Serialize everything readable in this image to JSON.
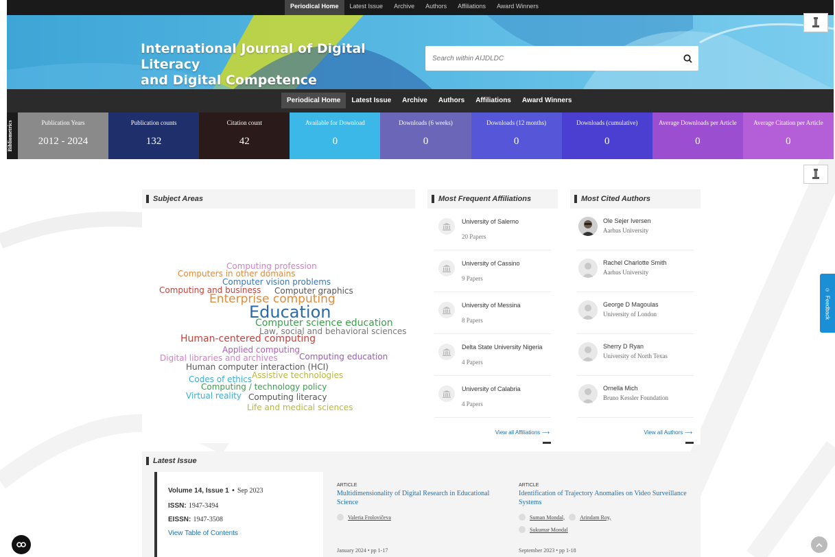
{
  "nav": {
    "tabs": [
      "Periodical Home",
      "Latest Issue",
      "Archive",
      "Authors",
      "Affiliations",
      "Award Winners"
    ],
    "active": "Periodical Home"
  },
  "banner": {
    "title_line1": "International Journal of Digital Literacy",
    "title_line2": "and Digital Competence",
    "search_placeholder": "Search within AIJDLDC"
  },
  "bibliometrics": {
    "label": "Bibliometrics",
    "metrics": [
      {
        "label": "Publication Years",
        "value": "2012 - 2024",
        "color": "#8a8a8a"
      },
      {
        "label": "Publication counts",
        "value": "132",
        "color": "#1f2f6b"
      },
      {
        "label": "Citation count",
        "value": "42",
        "color": "#2b1a1a"
      },
      {
        "label": "Available for Download",
        "value": "0",
        "color": "#3bb7e8"
      },
      {
        "label": "Downloads (6 weeks)",
        "value": "0",
        "color": "#6b66b8"
      },
      {
        "label": "Downloads (12 months)",
        "value": "0",
        "color": "#5656d8"
      },
      {
        "label": "Downloads (cumulative)",
        "value": "0",
        "color": "#4a3fd0"
      },
      {
        "label": "Average Downloads per Article",
        "value": "0",
        "color": "#9b4fd0"
      },
      {
        "label": "Average Citation per Article",
        "value": "0",
        "color": "#b45fd8"
      }
    ]
  },
  "feedback_label": "Feedback",
  "subject_areas": {
    "title": "Subject Areas",
    "words": [
      {
        "text": "Computing profession",
        "color": "#d47fc4"
      },
      {
        "text": "Computers in other domains",
        "color": "#e08b3a"
      },
      {
        "text": "Computer vision problems",
        "color": "#3a74b8"
      },
      {
        "text": "Computing and business",
        "color": "#c8403a"
      },
      {
        "text": "Computer graphics",
        "color": "#555555"
      },
      {
        "text": "Enterprise computing",
        "color": "#e08b3a"
      },
      {
        "text": "Education",
        "color": "#2a6aa8"
      },
      {
        "text": "Computer science education",
        "color": "#3aa04a"
      },
      {
        "text": "Law, social and behavioral sciences",
        "color": "#777777"
      },
      {
        "text": "Human-centered computing",
        "color": "#c8403a"
      },
      {
        "text": "Applied computing",
        "color": "#b65ac0"
      },
      {
        "text": "Digital libraries and archives",
        "color": "#d47fc4"
      },
      {
        "text": "Computing education",
        "color": "#9a5ab8"
      },
      {
        "text": "Human computer interaction (HCI)",
        "color": "#555555"
      },
      {
        "text": "Codes of ethics",
        "color": "#3aaed0"
      },
      {
        "text": "Assistive technologies",
        "color": "#b8b83a"
      },
      {
        "text": "Computing / technology policy",
        "color": "#3aa04a"
      },
      {
        "text": "Virtual reality",
        "color": "#3aaed0"
      },
      {
        "text": "Computing literacy",
        "color": "#555555"
      },
      {
        "text": "Life and medical sciences",
        "color": "#b8b83a"
      }
    ]
  },
  "affiliations": {
    "title": "Most Frequent Affiliations",
    "items": [
      {
        "name": "University of Salerno",
        "count": "20 Papers"
      },
      {
        "name": "University of Cassino",
        "count": "9 Papers"
      },
      {
        "name": "University of Messina",
        "count": "8 Papers"
      },
      {
        "name": "Delta State University Nigeria",
        "count": "4 Papers"
      },
      {
        "name": "University of Calabria",
        "count": "4 Papers"
      }
    ],
    "view_all": "View all Affiliations"
  },
  "authors": {
    "title": "Most Cited Authors",
    "items": [
      {
        "name": "Ole Sejer Iversen",
        "inst": "Aarhus University"
      },
      {
        "name": "Rachel Charlotte Smith",
        "inst": "Aarhus University"
      },
      {
        "name": "George D Magoulas",
        "inst": "University of London"
      },
      {
        "name": "Sherry D Ryan",
        "inst": "University of North Texas"
      },
      {
        "name": "Ornella Mich",
        "inst": "Bruno Kessler Foundation"
      }
    ],
    "view_all": "View all Authors"
  },
  "latest_issue": {
    "title": "Latest Issue",
    "volume": "Volume 14, Issue 1",
    "date": "Sep 2023",
    "issn_label": "ISSN:",
    "issn": "1947-3494",
    "eissn_label": "EISSN:",
    "eissn": "1947-3508",
    "toc_link": "View Table of Contents",
    "articles": [
      {
        "kind": "ARTICLE",
        "title": "Multidimensionality of Digital Research in Educational Science",
        "authors": [
          "Valeria Frolovičeva"
        ],
        "meta": "January 2024 • pp 1-17"
      },
      {
        "kind": "ARTICLE",
        "title": "Identification of Trajectory Anomalies on Video Surveillance Systems",
        "authors": [
          "Suman Mondal,",
          "Arindam Roy,",
          "Sukumar Mondal"
        ],
        "meta": "September 2023 • pp 1-18"
      }
    ]
  }
}
